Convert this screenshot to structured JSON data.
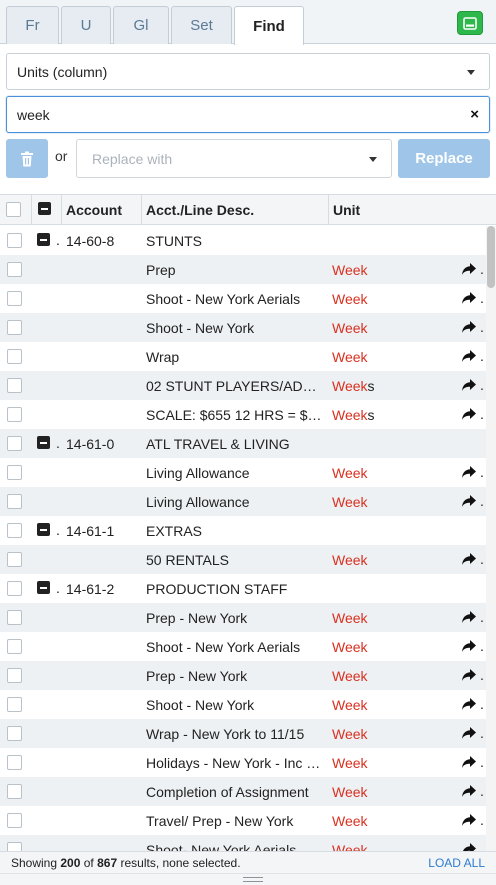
{
  "tabs": [
    "Fr",
    "U",
    "Gl",
    "Set",
    "Find"
  ],
  "active_tab": "Find",
  "search": {
    "field_select": "Units (column)",
    "find_value": "week",
    "clear_icon": "×",
    "or_label": "or",
    "replace_placeholder": "Replace with",
    "replace_button": "Replace"
  },
  "table": {
    "headers": {
      "account": "Account",
      "desc": "Acct./Line Desc.",
      "unit": "Unit"
    },
    "rows": [
      {
        "type": "group",
        "dot": ".",
        "account": "14-60-8",
        "desc": "STUNTS"
      },
      {
        "type": "line",
        "desc": "Prep",
        "unit_match": "Week",
        "unit_rest": ""
      },
      {
        "type": "line",
        "desc": "Shoot - New York Aerials",
        "unit_match": "Week",
        "unit_rest": ""
      },
      {
        "type": "line",
        "desc": "Shoot - New York",
        "unit_match": "Week",
        "unit_rest": ""
      },
      {
        "type": "line",
        "desc": "Wrap",
        "unit_match": "Week",
        "unit_rest": ""
      },
      {
        "type": "line",
        "desc": "02 STUNT PLAYERS/AD…",
        "unit_match": "Week",
        "unit_rest": "s"
      },
      {
        "type": "line",
        "desc": "SCALE: $655 12 HRS = $…",
        "unit_match": "Week",
        "unit_rest": "s"
      },
      {
        "type": "group",
        "dot": ".",
        "account": "14-61-0",
        "desc": "ATL TRAVEL & LIVING"
      },
      {
        "type": "line",
        "desc": "Living Allowance",
        "unit_match": "Week",
        "unit_rest": ""
      },
      {
        "type": "line",
        "desc": "Living Allowance",
        "unit_match": "Week",
        "unit_rest": ""
      },
      {
        "type": "group",
        "dot": ".",
        "account": "14-61-1",
        "desc": "EXTRAS"
      },
      {
        "type": "line",
        "desc": "50 RENTALS",
        "unit_match": "Week",
        "unit_rest": ""
      },
      {
        "type": "group",
        "dot": ".",
        "account": "14-61-2",
        "desc": "PRODUCTION STAFF"
      },
      {
        "type": "line",
        "desc": "Prep - New York",
        "unit_match": "Week",
        "unit_rest": ""
      },
      {
        "type": "line",
        "desc": "Shoot - New York Aerials",
        "unit_match": "Week",
        "unit_rest": ""
      },
      {
        "type": "line",
        "desc": "Prep - New York",
        "unit_match": "Week",
        "unit_rest": ""
      },
      {
        "type": "line",
        "desc": "Shoot - New York",
        "unit_match": "Week",
        "unit_rest": ""
      },
      {
        "type": "line",
        "desc": "Wrap - New York to 11/15",
        "unit_match": "Week",
        "unit_rest": ""
      },
      {
        "type": "line",
        "desc": "Holidays - New York - Inc …",
        "unit_match": "Week",
        "unit_rest": ""
      },
      {
        "type": "line",
        "desc": "Completion of Assignment",
        "unit_match": "Week",
        "unit_rest": ""
      },
      {
        "type": "line",
        "desc": "Travel/ Prep - New York",
        "unit_match": "Week",
        "unit_rest": ""
      },
      {
        "type": "line",
        "desc": "Shoot- New York Aerials",
        "unit_match": "Week",
        "unit_rest": ""
      }
    ]
  },
  "footer": {
    "prefix": "Showing",
    "shown": "200",
    "of": "of",
    "total": "867",
    "suffix": "results, none selected.",
    "load_all": "LOAD ALL"
  },
  "colors": {
    "match": "#d9301f",
    "accent": "#2e7bcf",
    "primary_disabled": "#9fc6e9",
    "green": "#2eb84b"
  }
}
